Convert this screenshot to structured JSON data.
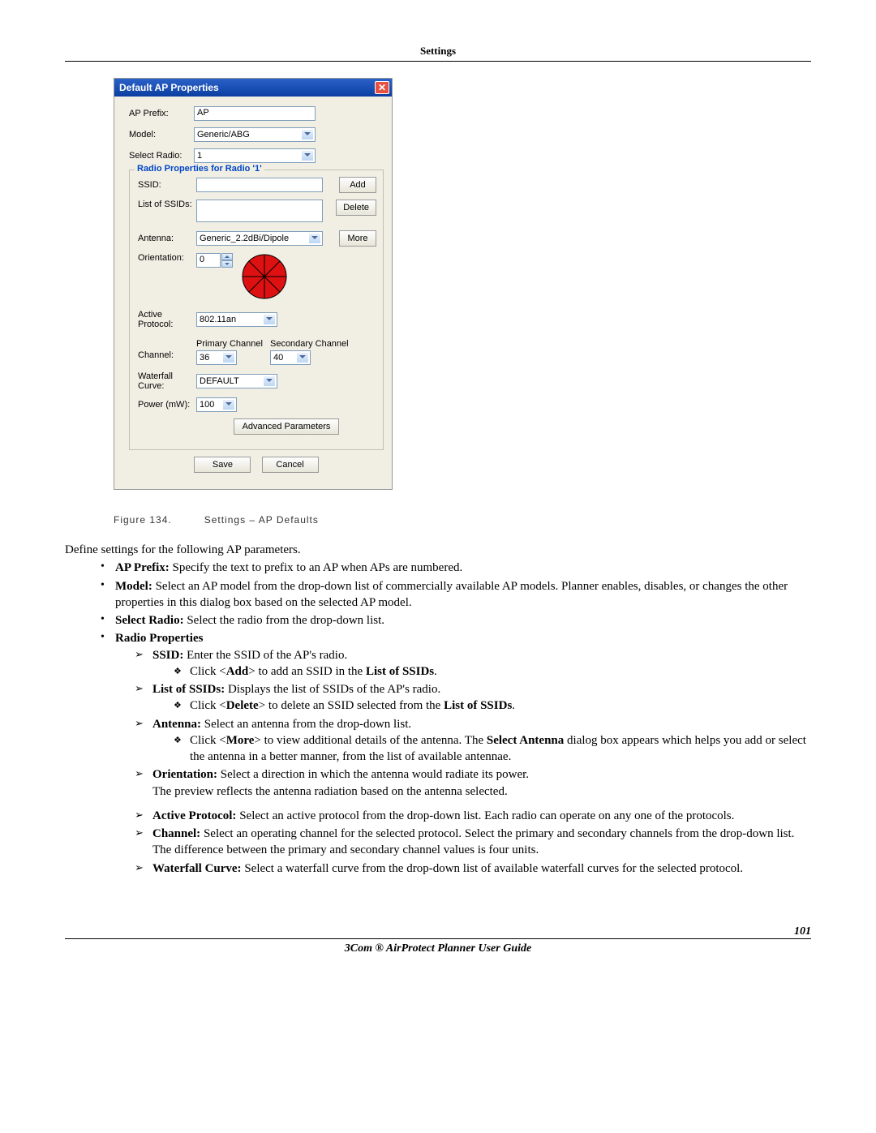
{
  "header": {
    "section": "Settings"
  },
  "dialog": {
    "title": "Default AP Properties",
    "ap_prefix_label": "AP Prefix:",
    "ap_prefix_value": "AP",
    "model_label": "Model:",
    "model_value": "Generic/ABG",
    "select_radio_label": "Select Radio:",
    "select_radio_value": "1",
    "fieldset_legend": "Radio Properties for Radio '1'",
    "ssid_label": "SSID:",
    "ssid_value": "",
    "add_btn": "Add",
    "list_ssids_label": "List of SSIDs:",
    "delete_btn": "Delete",
    "antenna_label": "Antenna:",
    "antenna_value": "Generic_2.2dBi/Dipole",
    "more_btn": "More",
    "orientation_label": "Orientation:",
    "orientation_value": "0",
    "active_protocol_label": "Active Protocol:",
    "active_protocol_value": "802.11an",
    "channel_label": "Channel:",
    "primary_channel_label": "Primary Channel",
    "primary_channel_value": "36",
    "secondary_channel_label": "Secondary Channel",
    "secondary_channel_value": "40",
    "waterfall_label": "Waterfall Curve:",
    "waterfall_value": "DEFAULT",
    "power_label": "Power (mW):",
    "power_value": "100",
    "advanced_btn": "Advanced Parameters",
    "save_btn": "Save",
    "cancel_btn": "Cancel"
  },
  "figure": {
    "num": "Figure 134.",
    "caption": "Settings – AP Defaults"
  },
  "content": {
    "intro": "Define settings for the following AP parameters.",
    "ap_prefix_b": "AP Prefix:",
    "ap_prefix_t": " Specify the text to prefix to an AP when APs are numbered.",
    "model_b": "Model:",
    "model_t": " Select an AP model from the drop-down list of commercially available AP models. Planner enables, disables, or changes the other properties in this dialog box based on the selected AP model.",
    "select_radio_b": "Select Radio:",
    "select_radio_t": " Select the radio from the drop-down list.",
    "radio_props_b": "Radio Properties",
    "ssid_b": "SSID:",
    "ssid_t": " Enter the SSID of the AP's radio.",
    "ssid_sub_pre": "Click <",
    "ssid_sub_b1": "Add",
    "ssid_sub_mid": "> to add an SSID in the ",
    "ssid_sub_b2": "List of SSIDs",
    "dot": ".",
    "list_ssids_b": "List of SSIDs:",
    "list_ssids_t": " Displays the list of SSIDs of the AP's radio.",
    "del_sub_pre": "Click <",
    "del_sub_b1": "Delete",
    "del_sub_mid": "> to delete an SSID selected from the ",
    "del_sub_b2": "List of SSIDs",
    "antenna_b": "Antenna:",
    "antenna_t": " Select an antenna from the drop-down list.",
    "more_sub_pre": "Click <",
    "more_sub_b1": "More",
    "more_sub_mid": "> to view additional details of the antenna. The ",
    "more_sub_b2": "Select Antenna",
    "more_sub_end": " dialog box appears which helps you add or select the antenna in a better manner, from the list of available antennae.",
    "orient_b": "Orientation:",
    "orient_t": " Select a direction in which the antenna would radiate its power.",
    "orient_line2": "The preview reflects the antenna radiation based on the antenna selected.",
    "active_b": "Active Protocol:",
    "active_t": " Select an active protocol from the drop-down list. Each radio can operate on any one of the protocols.",
    "channel_b": "Channel:",
    "channel_t": " Select an operating channel for the selected protocol. Select the primary and secondary channels from the drop-down list. The difference between the primary and secondary channel values is four units.",
    "waterfall_b": "Waterfall Curve:",
    "waterfall_t": " Select a waterfall curve from the drop-down list of available waterfall curves for the selected protocol."
  },
  "footer": {
    "page_num": "101",
    "guide": "3Com ® AirProtect Planner User Guide"
  }
}
